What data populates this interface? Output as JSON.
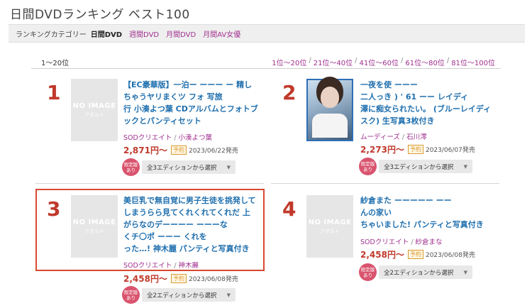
{
  "page": {
    "title": "日間DVDランキング ベスト100"
  },
  "category_bar": {
    "label": "ランキングカテゴリー",
    "items": [
      {
        "label": "日間DVD",
        "active": true
      },
      {
        "label": "週間DVD",
        "active": false
      },
      {
        "label": "月間DVD",
        "active": false
      },
      {
        "label": "月間AV女優",
        "active": false
      }
    ]
  },
  "range": {
    "current": "1〜20位",
    "links": [
      "1位〜20位",
      "21位〜40位",
      "41位〜60位",
      "61位〜80位",
      "81位〜100位"
    ]
  },
  "items": [
    {
      "rank": "1",
      "thumb": {
        "type": "noimage",
        "text": "NO IMAGE",
        "sub": "アダルト"
      },
      "title_lines": [
        "【EC豪華版】一泊ー ーーー ー 精し",
        "ちゃうヤリまくツ フォ 写旅",
        "行 小湊よつ葉 CDアルバムとフォトブ",
        "ックとパンティセット"
      ],
      "maker": "SODクリエイト",
      "performer": "小湊よつ葉",
      "price": "2,871円〜",
      "status": "予約",
      "release": "2023/06/22発売",
      "limited": [
        "限定版",
        "あり"
      ],
      "edition_select": "全3エディションから選択"
    },
    {
      "rank": "2",
      "thumb": {
        "type": "photo"
      },
      "title_lines": [
        "一夜を使 ーーー",
        "二人っき  ) ' 61 ーー レイディ",
        "澤に痴女られたい。 (ブルーレイディ",
        "スク) 生写真3枚付き"
      ],
      "maker": "ムーディーズ",
      "performer": "石川澪",
      "price": "2,273円〜",
      "status": "予約",
      "release": "2023/06/07発売",
      "limited": [
        "限定版",
        "あり"
      ],
      "edition_select": "全3エディションから選択"
    },
    {
      "rank": "3",
      "thumb": {
        "type": "noimage",
        "text": "NO IMAGE",
        "sub": "アダルト"
      },
      "title_lines": [
        "美巨乳で無自覚に男子生徒を挑発して",
        "しまうらら見てくれくれてくれだ 上",
        "がらなのデーーーー ーーーな",
        "くチ〇ポ ーーー くれを",
        "った…! 神木麗 パンティと写真付き"
      ],
      "maker": "SODクリエイト",
      "performer": "神木麗",
      "price": "2,458円〜",
      "status": "予約",
      "release": "2023/06/08発売",
      "limited": [
        "限定版",
        "あり"
      ],
      "edition_select": "全2エディションから選択"
    },
    {
      "rank": "4",
      "thumb": {
        "type": "noimage",
        "text": "NO IMAGE",
        "sub": "アダルト"
      },
      "title_lines": [
        "紗倉また ーーーーー ーー",
        "んの家い",
        "ちゃいました! パンティと写真付き"
      ],
      "maker": "SODクリエイト",
      "performer": "紗倉まな",
      "price": "2,458円〜",
      "status": "予約",
      "release": "2023/06/08発売",
      "limited": [
        "限定版",
        "あり"
      ],
      "edition_select": "全2エディションから選択"
    }
  ],
  "colors": {
    "rank": "#c0392b",
    "title": "#1f6fae",
    "maker": "#a0308f",
    "highlight": "#d9492f",
    "limited_badge": "#d9546e"
  }
}
